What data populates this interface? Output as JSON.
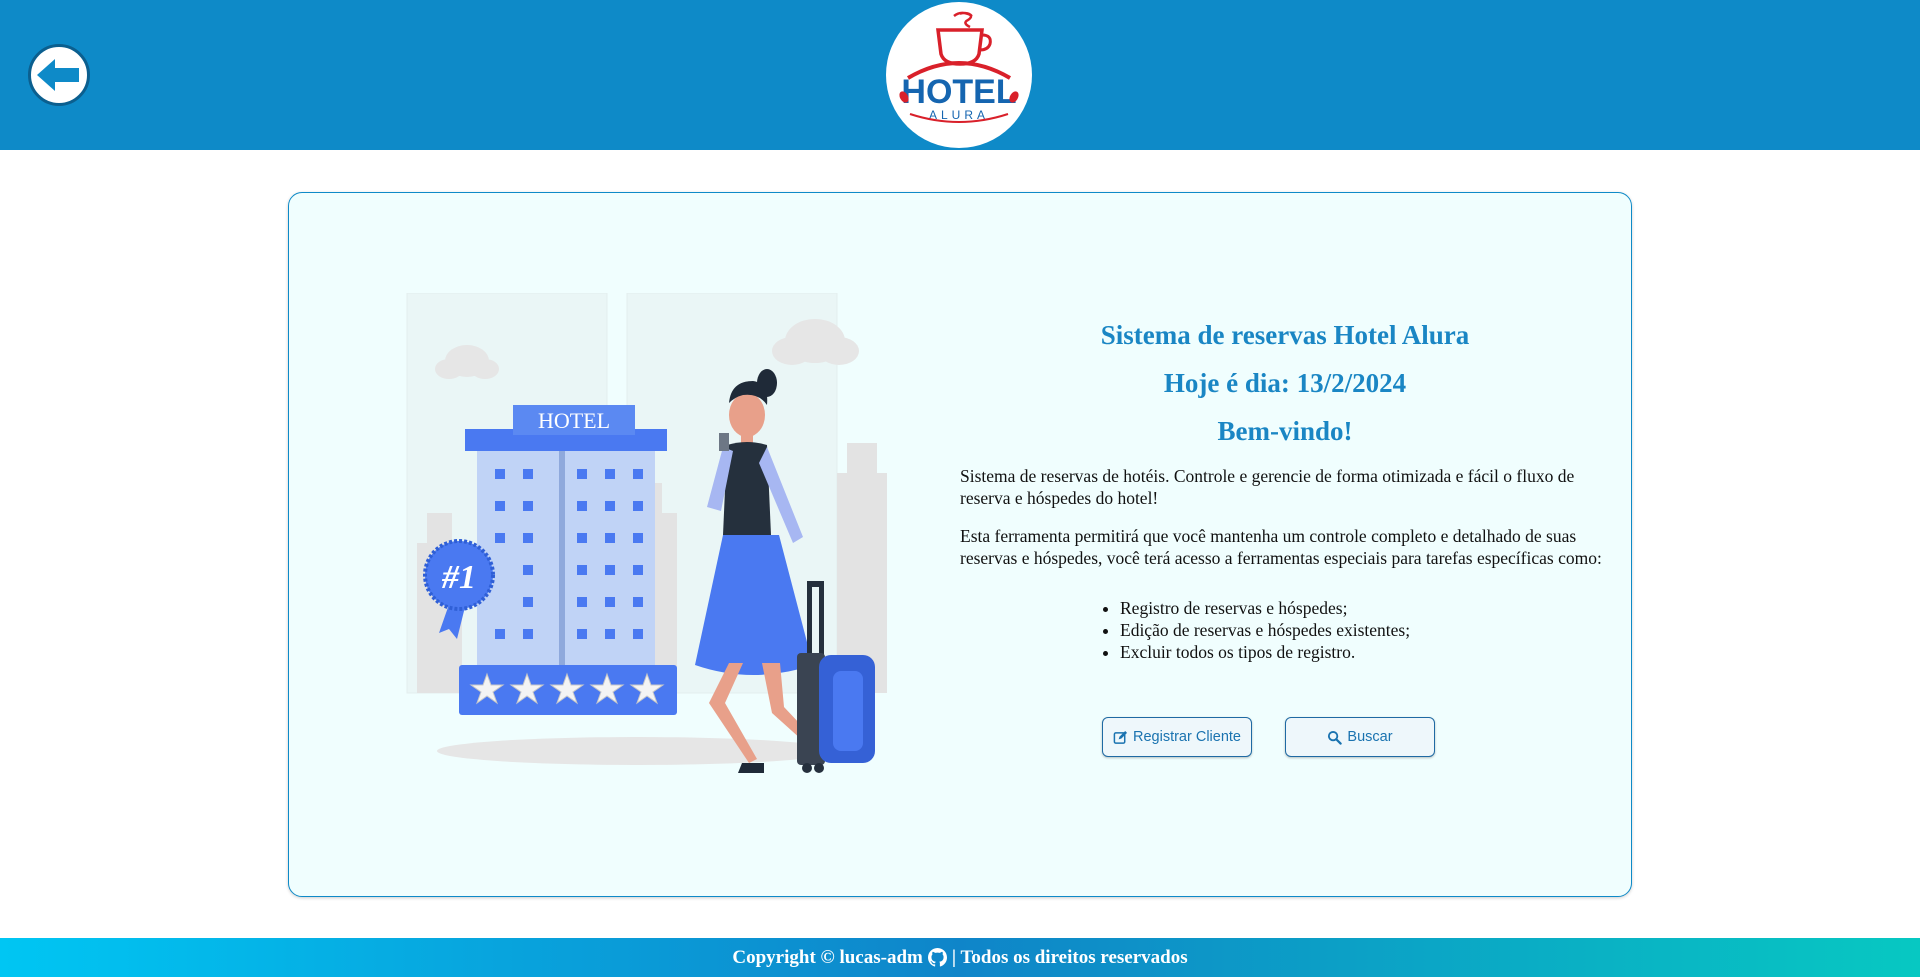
{
  "header": {
    "back_icon": "arrow-left-icon",
    "logo": {
      "main_text": "HOTEL",
      "sub_text": "ALURA",
      "icon": "coffee-cup-icon"
    }
  },
  "illustration": {
    "sign_text": "HOTEL",
    "badge_text": "#1",
    "rating_stars": 5,
    "description_icons": [
      "hotel-building-icon",
      "traveler-woman-icon",
      "suitcase-icon"
    ]
  },
  "main": {
    "title": "Sistema de reservas Hotel Alura",
    "date_line": "Hoje é dia: 13/2/2024",
    "welcome": "Bem-vindo!",
    "paragraph1": "Sistema de reservas de hotéis. Controle e gerencie de forma otimizada e fácil o fluxo de reserva e hóspedes do hotel!",
    "paragraph2": "Esta ferramenta permitirá que você mantenha um controle completo e detalhado de suas reservas e hóspedes, você terá acesso a ferramentas especiais para tarefas específicas como:",
    "features": [
      "Registro de reservas e hóspedes;",
      "Edição de reservas e hóspedes existentes;",
      "Excluir todos os tipos de registro."
    ],
    "register_button": {
      "label": "Registrar Cliente",
      "icon": "edit-icon"
    },
    "search_button": {
      "label": "Buscar",
      "icon": "search-icon"
    }
  },
  "footer": {
    "prefix": "Copyright © lucas-adm",
    "icon": "github-icon",
    "suffix": "| Todos os direitos reservados"
  },
  "colors": {
    "header_bg": "#0e8ac8",
    "accent": "#1a86c4",
    "card_bg": "#f0fefe",
    "logo_red": "#d9202a",
    "logo_blue": "#1565b0"
  }
}
